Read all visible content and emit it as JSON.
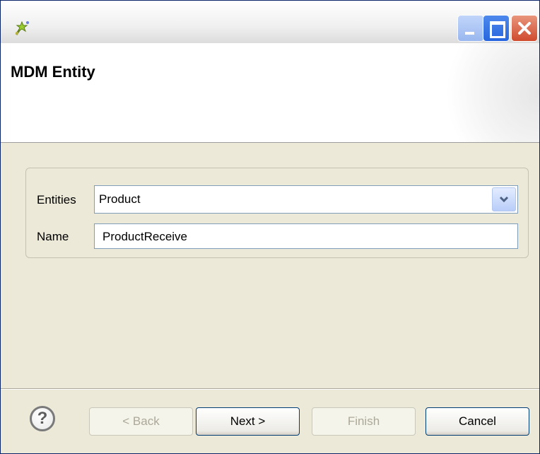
{
  "window": {
    "title_icon": "wizard-icon",
    "controls": {
      "minimize": "minimize-icon",
      "maximize": "maximize-icon",
      "close": "close-icon"
    }
  },
  "banner": {
    "title": "MDM Entity"
  },
  "form": {
    "entities_label": "Entities",
    "entities_value": "Product",
    "name_label": "Name",
    "name_value": "ProductReceive"
  },
  "footer": {
    "help_glyph": "?",
    "back_label": "< Back",
    "next_label": "Next >",
    "finish_label": "Finish",
    "cancel_label": "Cancel"
  }
}
